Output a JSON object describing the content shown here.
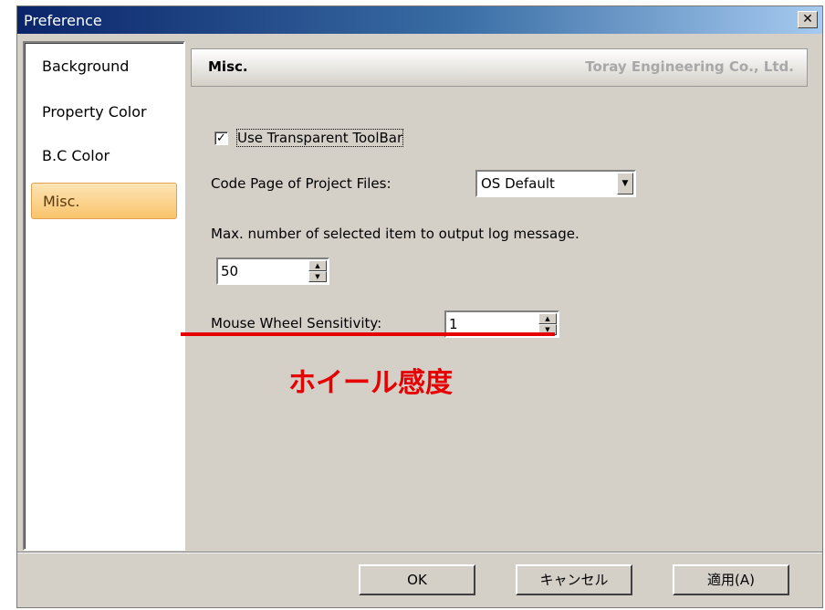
{
  "window": {
    "title": "Preference",
    "close_symbol": "✕"
  },
  "sidebar": {
    "items": [
      {
        "label": "Background",
        "active": false
      },
      {
        "label": "Property Color",
        "active": false
      },
      {
        "label": "B.C Color",
        "active": false
      },
      {
        "label": "Misc.",
        "active": true
      }
    ]
  },
  "panel": {
    "title": "Misc.",
    "company": "Toray Engineering Co., Ltd."
  },
  "settings": {
    "transparent_toolbar": {
      "label": "Use Transparent ToolBar",
      "checked": true,
      "check_symbol": "✓"
    },
    "code_page": {
      "label": "Code Page of Project Files:",
      "value": "OS Default"
    },
    "max_items": {
      "label": "Max. number of selected item to output log message.",
      "value": "50"
    },
    "wheel": {
      "label": "Mouse Wheel Sensitivity:",
      "value": "1"
    }
  },
  "annotation": {
    "text": "ホイール感度",
    "color": "#e60000"
  },
  "buttons": {
    "ok": "OK",
    "cancel": "キャンセル",
    "apply": "適用(A)"
  },
  "glyphs": {
    "dropdown": "▼",
    "spin_up": "▲",
    "spin_down": "▼"
  },
  "colors": {
    "titlebar_start": "#0a246a",
    "titlebar_end": "#a6caf0",
    "active_item": "#f9c46b"
  }
}
